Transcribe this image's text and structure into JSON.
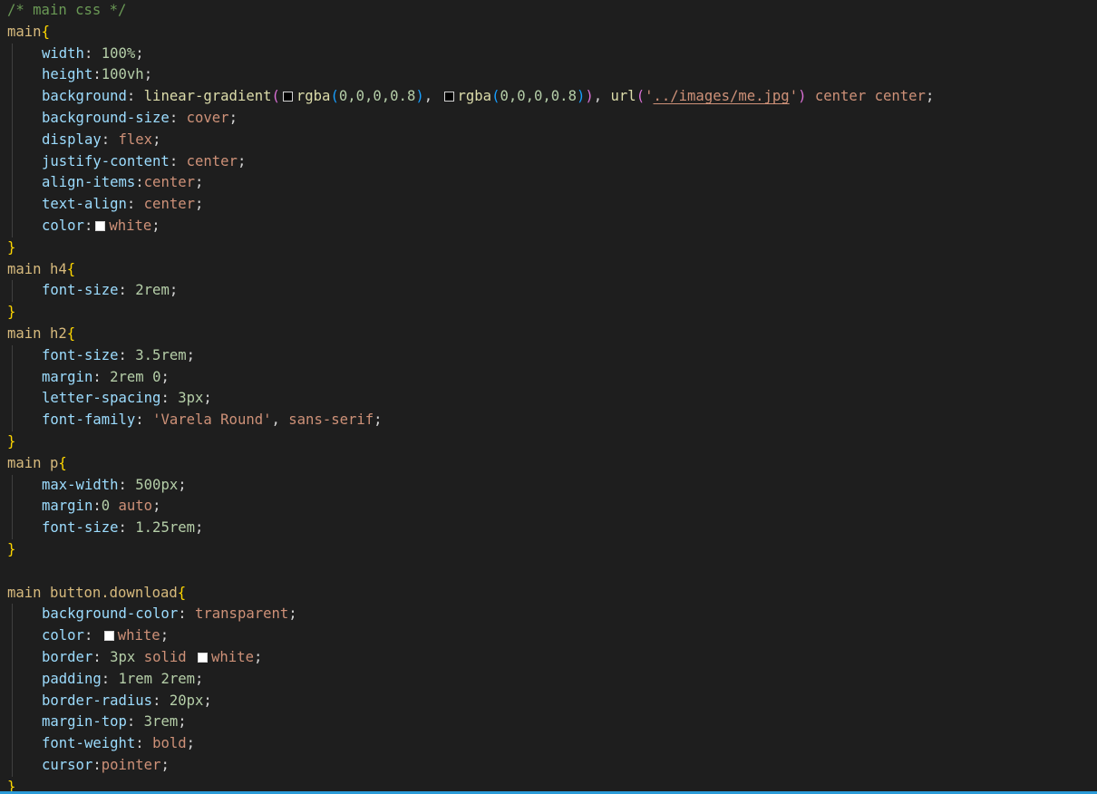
{
  "editor": {
    "language": "css",
    "accent_color": "#2b9bd8",
    "lines": [
      {
        "indent": false,
        "tokens": [
          {
            "t": "cmt",
            "v": "/* main css */"
          }
        ]
      },
      {
        "indent": false,
        "tokens": [
          {
            "t": "sel",
            "v": "main"
          },
          {
            "t": "b1",
            "v": "{"
          }
        ]
      },
      {
        "indent": true,
        "tokens": [
          {
            "t": "prop",
            "v": "width"
          },
          {
            "t": "pun",
            "v": ": "
          },
          {
            "t": "num",
            "v": "100%"
          },
          {
            "t": "pun",
            "v": ";"
          }
        ]
      },
      {
        "indent": true,
        "tokens": [
          {
            "t": "prop",
            "v": "height"
          },
          {
            "t": "pun",
            "v": ":"
          },
          {
            "t": "num",
            "v": "100vh"
          },
          {
            "t": "pun",
            "v": ";"
          }
        ]
      },
      {
        "indent": true,
        "tokens": [
          {
            "t": "prop",
            "v": "background"
          },
          {
            "t": "pun",
            "v": ": "
          },
          {
            "t": "fn",
            "v": "linear-gradient"
          },
          {
            "t": "b2",
            "v": "("
          },
          {
            "t": "swatch",
            "v": "",
            "color": "#000000"
          },
          {
            "t": "fn",
            "v": "rgba"
          },
          {
            "t": "b3",
            "v": "("
          },
          {
            "t": "num",
            "v": "0,0,0,0.8"
          },
          {
            "t": "b3",
            "v": ")"
          },
          {
            "t": "pun",
            "v": ", "
          },
          {
            "t": "swatch",
            "v": "",
            "color": "#000000"
          },
          {
            "t": "fn",
            "v": "rgba"
          },
          {
            "t": "b3",
            "v": "("
          },
          {
            "t": "num",
            "v": "0,0,0,0.8"
          },
          {
            "t": "b3",
            "v": ")"
          },
          {
            "t": "b2",
            "v": ")"
          },
          {
            "t": "pun",
            "v": ", "
          },
          {
            "t": "fn",
            "v": "url"
          },
          {
            "t": "b2",
            "v": "("
          },
          {
            "t": "str",
            "v": "'"
          },
          {
            "t": "url",
            "v": "../images/me.jpg"
          },
          {
            "t": "str",
            "v": "'"
          },
          {
            "t": "b2",
            "v": ")"
          },
          {
            "t": "pun",
            "v": " "
          },
          {
            "t": "val",
            "v": "center center"
          },
          {
            "t": "pun",
            "v": ";"
          }
        ]
      },
      {
        "indent": true,
        "tokens": [
          {
            "t": "prop",
            "v": "background-size"
          },
          {
            "t": "pun",
            "v": ": "
          },
          {
            "t": "val",
            "v": "cover"
          },
          {
            "t": "pun",
            "v": ";"
          }
        ]
      },
      {
        "indent": true,
        "tokens": [
          {
            "t": "prop",
            "v": "display"
          },
          {
            "t": "pun",
            "v": ": "
          },
          {
            "t": "val",
            "v": "flex"
          },
          {
            "t": "pun",
            "v": ";"
          }
        ]
      },
      {
        "indent": true,
        "tokens": [
          {
            "t": "prop",
            "v": "justify-content"
          },
          {
            "t": "pun",
            "v": ": "
          },
          {
            "t": "val",
            "v": "center"
          },
          {
            "t": "pun",
            "v": ";"
          }
        ]
      },
      {
        "indent": true,
        "tokens": [
          {
            "t": "prop",
            "v": "align-items"
          },
          {
            "t": "pun",
            "v": ":"
          },
          {
            "t": "val",
            "v": "center"
          },
          {
            "t": "pun",
            "v": ";"
          }
        ]
      },
      {
        "indent": true,
        "tokens": [
          {
            "t": "prop",
            "v": "text-align"
          },
          {
            "t": "pun",
            "v": ": "
          },
          {
            "t": "val",
            "v": "center"
          },
          {
            "t": "pun",
            "v": ";"
          }
        ]
      },
      {
        "indent": true,
        "tokens": [
          {
            "t": "prop",
            "v": "color"
          },
          {
            "t": "pun",
            "v": ":"
          },
          {
            "t": "swatch",
            "v": "",
            "color": "#ffffff"
          },
          {
            "t": "val",
            "v": "white"
          },
          {
            "t": "pun",
            "v": ";"
          }
        ]
      },
      {
        "indent": false,
        "tokens": [
          {
            "t": "b1",
            "v": "}"
          }
        ]
      },
      {
        "indent": false,
        "tokens": [
          {
            "t": "sel",
            "v": "main h4"
          },
          {
            "t": "b1",
            "v": "{"
          }
        ]
      },
      {
        "indent": true,
        "tokens": [
          {
            "t": "prop",
            "v": "font-size"
          },
          {
            "t": "pun",
            "v": ": "
          },
          {
            "t": "num",
            "v": "2rem"
          },
          {
            "t": "pun",
            "v": ";"
          }
        ]
      },
      {
        "indent": false,
        "tokens": [
          {
            "t": "b1",
            "v": "}"
          }
        ]
      },
      {
        "indent": false,
        "tokens": [
          {
            "t": "sel",
            "v": "main h2"
          },
          {
            "t": "b1",
            "v": "{"
          }
        ]
      },
      {
        "indent": true,
        "tokens": [
          {
            "t": "prop",
            "v": "font-size"
          },
          {
            "t": "pun",
            "v": ": "
          },
          {
            "t": "num",
            "v": "3.5rem"
          },
          {
            "t": "pun",
            "v": ";"
          }
        ]
      },
      {
        "indent": true,
        "tokens": [
          {
            "t": "prop",
            "v": "margin"
          },
          {
            "t": "pun",
            "v": ": "
          },
          {
            "t": "num",
            "v": "2rem 0"
          },
          {
            "t": "pun",
            "v": ";"
          }
        ]
      },
      {
        "indent": true,
        "tokens": [
          {
            "t": "prop",
            "v": "letter-spacing"
          },
          {
            "t": "pun",
            "v": ": "
          },
          {
            "t": "num",
            "v": "3px"
          },
          {
            "t": "pun",
            "v": ";"
          }
        ]
      },
      {
        "indent": true,
        "tokens": [
          {
            "t": "prop",
            "v": "font-family"
          },
          {
            "t": "pun",
            "v": ": "
          },
          {
            "t": "str",
            "v": "'Varela Round'"
          },
          {
            "t": "pun",
            "v": ", "
          },
          {
            "t": "val",
            "v": "sans-serif"
          },
          {
            "t": "pun",
            "v": ";"
          }
        ]
      },
      {
        "indent": false,
        "tokens": [
          {
            "t": "b1",
            "v": "}"
          }
        ]
      },
      {
        "indent": false,
        "tokens": [
          {
            "t": "sel",
            "v": "main p"
          },
          {
            "t": "b1",
            "v": "{"
          }
        ]
      },
      {
        "indent": true,
        "tokens": [
          {
            "t": "prop",
            "v": "max-width"
          },
          {
            "t": "pun",
            "v": ": "
          },
          {
            "t": "num",
            "v": "500px"
          },
          {
            "t": "pun",
            "v": ";"
          }
        ]
      },
      {
        "indent": true,
        "tokens": [
          {
            "t": "prop",
            "v": "margin"
          },
          {
            "t": "pun",
            "v": ":"
          },
          {
            "t": "num",
            "v": "0"
          },
          {
            "t": "pun",
            "v": " "
          },
          {
            "t": "val",
            "v": "auto"
          },
          {
            "t": "pun",
            "v": ";"
          }
        ]
      },
      {
        "indent": true,
        "tokens": [
          {
            "t": "prop",
            "v": "font-size"
          },
          {
            "t": "pun",
            "v": ": "
          },
          {
            "t": "num",
            "v": "1.25rem"
          },
          {
            "t": "pun",
            "v": ";"
          }
        ]
      },
      {
        "indent": false,
        "tokens": [
          {
            "t": "b1",
            "v": "}"
          }
        ]
      },
      {
        "indent": false,
        "tokens": []
      },
      {
        "indent": false,
        "tokens": [
          {
            "t": "sel",
            "v": "main button.download"
          },
          {
            "t": "b1",
            "v": "{"
          }
        ]
      },
      {
        "indent": true,
        "tokens": [
          {
            "t": "prop",
            "v": "background-color"
          },
          {
            "t": "pun",
            "v": ": "
          },
          {
            "t": "val",
            "v": "transparent"
          },
          {
            "t": "pun",
            "v": ";"
          }
        ]
      },
      {
        "indent": true,
        "tokens": [
          {
            "t": "prop",
            "v": "color"
          },
          {
            "t": "pun",
            "v": ": "
          },
          {
            "t": "swatch",
            "v": "",
            "color": "#ffffff"
          },
          {
            "t": "val",
            "v": "white"
          },
          {
            "t": "pun",
            "v": ";"
          }
        ]
      },
      {
        "indent": true,
        "tokens": [
          {
            "t": "prop",
            "v": "border"
          },
          {
            "t": "pun",
            "v": ": "
          },
          {
            "t": "num",
            "v": "3px"
          },
          {
            "t": "pun",
            "v": " "
          },
          {
            "t": "val",
            "v": "solid"
          },
          {
            "t": "pun",
            "v": " "
          },
          {
            "t": "swatch",
            "v": "",
            "color": "#ffffff"
          },
          {
            "t": "val",
            "v": "white"
          },
          {
            "t": "pun",
            "v": ";"
          }
        ]
      },
      {
        "indent": true,
        "tokens": [
          {
            "t": "prop",
            "v": "padding"
          },
          {
            "t": "pun",
            "v": ": "
          },
          {
            "t": "num",
            "v": "1rem 2rem"
          },
          {
            "t": "pun",
            "v": ";"
          }
        ]
      },
      {
        "indent": true,
        "tokens": [
          {
            "t": "prop",
            "v": "border-radius"
          },
          {
            "t": "pun",
            "v": ": "
          },
          {
            "t": "num",
            "v": "20px"
          },
          {
            "t": "pun",
            "v": ";"
          }
        ]
      },
      {
        "indent": true,
        "tokens": [
          {
            "t": "prop",
            "v": "margin-top"
          },
          {
            "t": "pun",
            "v": ": "
          },
          {
            "t": "num",
            "v": "3rem"
          },
          {
            "t": "pun",
            "v": ";"
          }
        ]
      },
      {
        "indent": true,
        "tokens": [
          {
            "t": "prop",
            "v": "font-weight"
          },
          {
            "t": "pun",
            "v": ": "
          },
          {
            "t": "val",
            "v": "bold"
          },
          {
            "t": "pun",
            "v": ";"
          }
        ]
      },
      {
        "indent": true,
        "tokens": [
          {
            "t": "prop",
            "v": "cursor"
          },
          {
            "t": "pun",
            "v": ":"
          },
          {
            "t": "val",
            "v": "pointer"
          },
          {
            "t": "pun",
            "v": ";"
          }
        ]
      },
      {
        "indent": false,
        "tokens": [
          {
            "t": "b1",
            "v": "}"
          }
        ]
      }
    ]
  }
}
